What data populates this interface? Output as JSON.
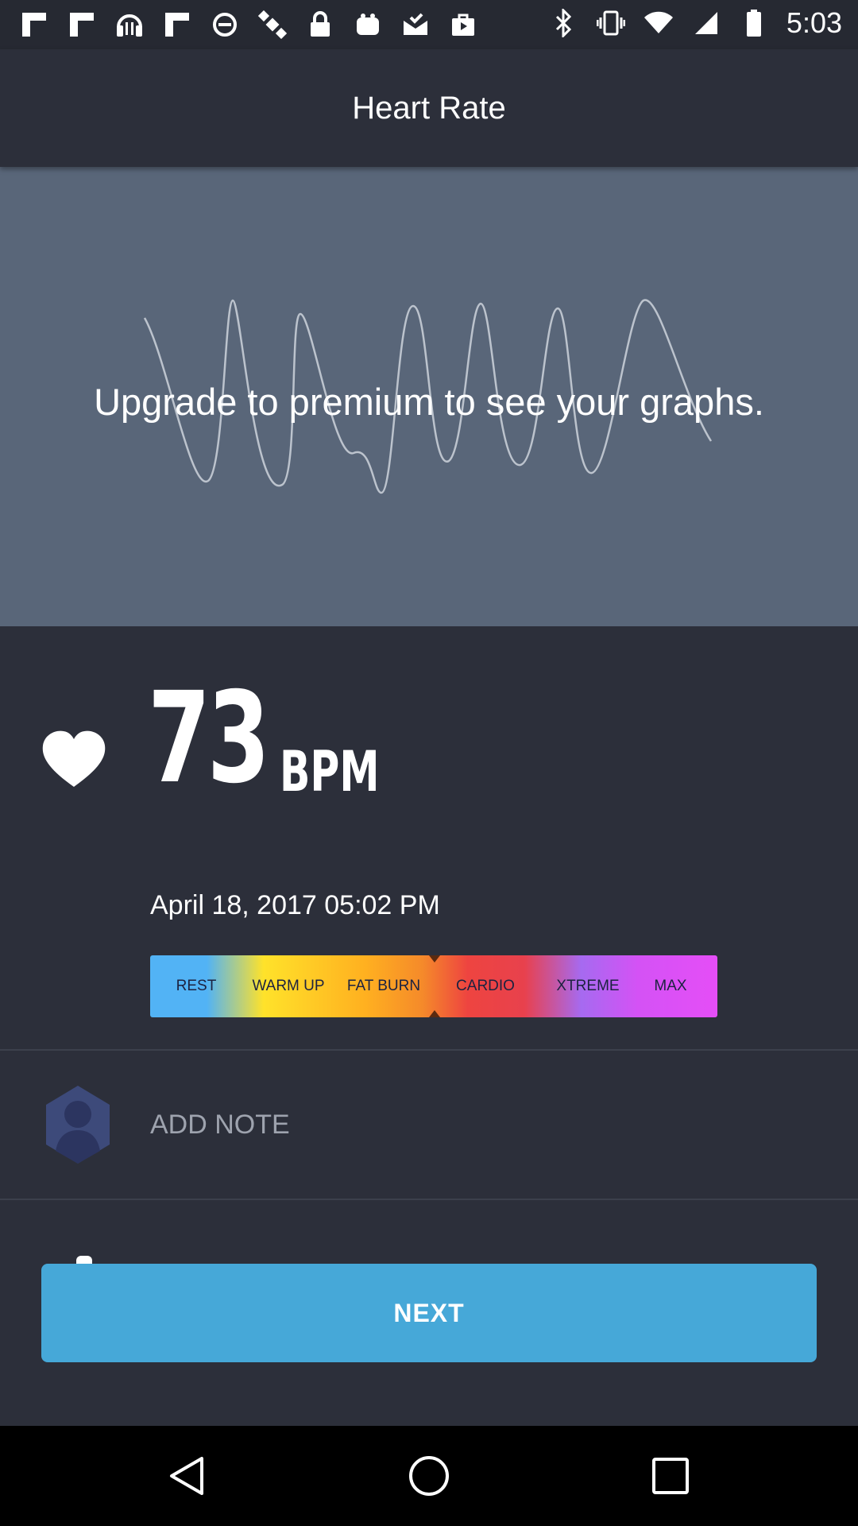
{
  "status_bar": {
    "time": "5:03",
    "left_icons": [
      "flipboard-icon",
      "flipboard-icon",
      "headset-icon",
      "flipboard-icon",
      "blocked-icon",
      "satellite-icon",
      "lock-icon",
      "bag-icon",
      "mail-check-icon",
      "play-bag-icon"
    ],
    "right_icons": [
      "bluetooth-icon",
      "vibrate-icon",
      "wifi-icon",
      "signal-icon",
      "battery-icon"
    ]
  },
  "app_bar": {
    "title": "Heart Rate"
  },
  "graph": {
    "message": "Upgrade to premium to see your graphs."
  },
  "reading": {
    "value": "73",
    "unit": "BPM",
    "timestamp": "April 18, 2017 05:02 PM"
  },
  "zones": {
    "labels": [
      "REST",
      "WARM UP",
      "FAT BURN",
      "CARDIO",
      "XTREME",
      "MAX"
    ],
    "colors": [
      "#52b3f5",
      "#ffe22a",
      "#f58a2a",
      "#ee4440",
      "#a66af0",
      "#e54ef7"
    ]
  },
  "note": {
    "label": "ADD NOTE"
  },
  "next_button": {
    "label": "NEXT"
  },
  "colors": {
    "background": "#2c2f3a",
    "graph_panel": "#596679",
    "accent": "#46a8d8"
  }
}
